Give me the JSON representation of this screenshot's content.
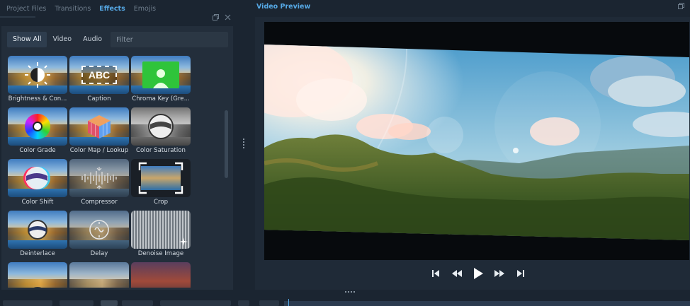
{
  "dock_tabs": [
    {
      "label": "Project Files",
      "active": false
    },
    {
      "label": "Transitions",
      "active": false
    },
    {
      "label": "Effects",
      "active": true
    },
    {
      "label": "Emojis",
      "active": false
    }
  ],
  "filters": {
    "show_all": "Show All",
    "video": "Video",
    "audio": "Audio",
    "placeholder": "Filter"
  },
  "effects": [
    {
      "label": "Brightness & Con...",
      "icon": "brightness-icon"
    },
    {
      "label": "Caption",
      "icon": "caption-icon",
      "icon_text": "ABC"
    },
    {
      "label": "Chroma Key (Gre...",
      "icon": "chroma-key-icon"
    },
    {
      "label": "Color Grade",
      "icon": "color-wheel-icon"
    },
    {
      "label": "Color Map / Lookup",
      "icon": "color-cube-icon"
    },
    {
      "label": "Color Saturation",
      "icon": "saturation-icon"
    },
    {
      "label": "Color Shift",
      "icon": "color-shift-icon"
    },
    {
      "label": "Compressor",
      "icon": "waveform-icon"
    },
    {
      "label": "Crop",
      "icon": "crop-icon"
    },
    {
      "label": "Deinterlace",
      "icon": "deinterlace-icon"
    },
    {
      "label": "Delay",
      "icon": "delay-icon"
    },
    {
      "label": "Denoise Image",
      "icon": "denoise-icon"
    },
    {
      "label": "",
      "icon": "ball-icon"
    },
    {
      "label": "",
      "icon": "speaker-icon"
    },
    {
      "label": "",
      "icon": "echo-icon"
    }
  ],
  "preview": {
    "title": "Video Preview"
  },
  "player_controls": [
    {
      "name": "jump-start-button",
      "icon": "skip-start-icon"
    },
    {
      "name": "rewind-button",
      "icon": "rewind-icon"
    },
    {
      "name": "play-button",
      "icon": "play-icon"
    },
    {
      "name": "fast-forward-button",
      "icon": "fast-forward-icon"
    },
    {
      "name": "jump-end-button",
      "icon": "skip-end-icon"
    }
  ],
  "colors": {
    "accent": "#56a9e6",
    "panel_bg": "#1b2531",
    "panel_inner": "#232e3b"
  }
}
